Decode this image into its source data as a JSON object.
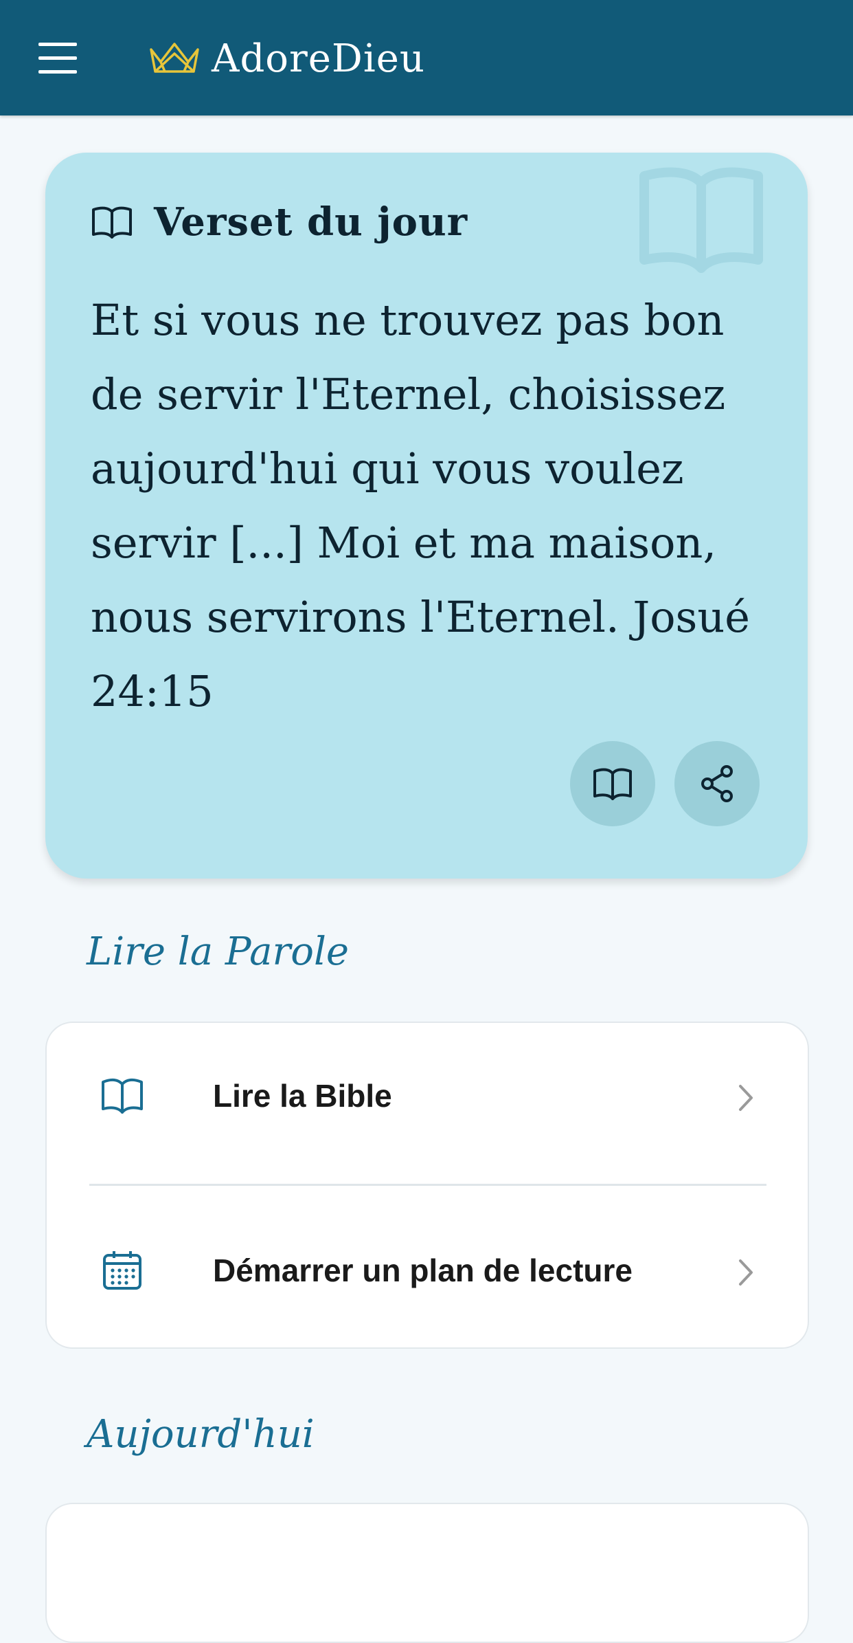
{
  "appbar": {
    "title": "AdoreDieu",
    "menu_icon": "hamburger-menu-icon",
    "logo_icon": "crown-icon",
    "background_color": "#115a78",
    "logo_color": "#e7c53a"
  },
  "verse_card": {
    "heading": "Verset du jour",
    "text": "Et si vous ne trouvez pas bon de servir l'Eternel, choisissez aujourd'hui qui vous voulez servir [...] Moi et ma maison, nous servirons l'Eternel. Josué 24:15",
    "background_color": "#b6e4ee",
    "heading_icon": "book-open-icon",
    "watermark_icon": "book-open-icon",
    "actions": [
      {
        "name": "read",
        "icon": "book-open-icon"
      },
      {
        "name": "share",
        "icon": "share-icon"
      }
    ]
  },
  "sections": {
    "read_word": {
      "title": "Lire la Parole",
      "items": [
        {
          "label": "Lire la Bible",
          "icon": "book-open-icon"
        },
        {
          "label": "Démarrer un plan de lecture",
          "icon": "calendar-icon"
        }
      ]
    },
    "today": {
      "title": "Aujourd'hui"
    }
  },
  "accent_color": "#1a6e93"
}
